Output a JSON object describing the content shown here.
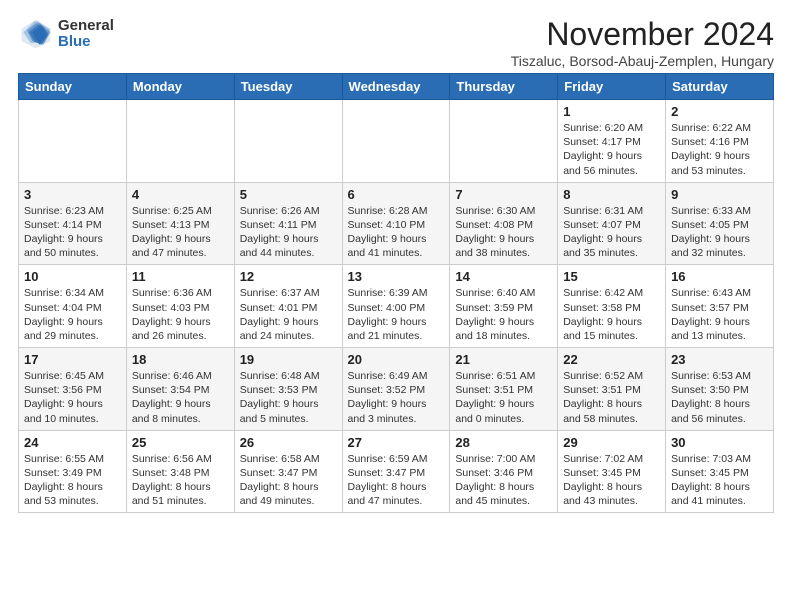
{
  "logo": {
    "general": "General",
    "blue": "Blue"
  },
  "title": "November 2024",
  "location": "Tiszaluc, Borsod-Abauj-Zemplen, Hungary",
  "days_of_week": [
    "Sunday",
    "Monday",
    "Tuesday",
    "Wednesday",
    "Thursday",
    "Friday",
    "Saturday"
  ],
  "weeks": [
    [
      {
        "day": "",
        "info": ""
      },
      {
        "day": "",
        "info": ""
      },
      {
        "day": "",
        "info": ""
      },
      {
        "day": "",
        "info": ""
      },
      {
        "day": "",
        "info": ""
      },
      {
        "day": "1",
        "info": "Sunrise: 6:20 AM\nSunset: 4:17 PM\nDaylight: 9 hours and 56 minutes."
      },
      {
        "day": "2",
        "info": "Sunrise: 6:22 AM\nSunset: 4:16 PM\nDaylight: 9 hours and 53 minutes."
      }
    ],
    [
      {
        "day": "3",
        "info": "Sunrise: 6:23 AM\nSunset: 4:14 PM\nDaylight: 9 hours and 50 minutes."
      },
      {
        "day": "4",
        "info": "Sunrise: 6:25 AM\nSunset: 4:13 PM\nDaylight: 9 hours and 47 minutes."
      },
      {
        "day": "5",
        "info": "Sunrise: 6:26 AM\nSunset: 4:11 PM\nDaylight: 9 hours and 44 minutes."
      },
      {
        "day": "6",
        "info": "Sunrise: 6:28 AM\nSunset: 4:10 PM\nDaylight: 9 hours and 41 minutes."
      },
      {
        "day": "7",
        "info": "Sunrise: 6:30 AM\nSunset: 4:08 PM\nDaylight: 9 hours and 38 minutes."
      },
      {
        "day": "8",
        "info": "Sunrise: 6:31 AM\nSunset: 4:07 PM\nDaylight: 9 hours and 35 minutes."
      },
      {
        "day": "9",
        "info": "Sunrise: 6:33 AM\nSunset: 4:05 PM\nDaylight: 9 hours and 32 minutes."
      }
    ],
    [
      {
        "day": "10",
        "info": "Sunrise: 6:34 AM\nSunset: 4:04 PM\nDaylight: 9 hours and 29 minutes."
      },
      {
        "day": "11",
        "info": "Sunrise: 6:36 AM\nSunset: 4:03 PM\nDaylight: 9 hours and 26 minutes."
      },
      {
        "day": "12",
        "info": "Sunrise: 6:37 AM\nSunset: 4:01 PM\nDaylight: 9 hours and 24 minutes."
      },
      {
        "day": "13",
        "info": "Sunrise: 6:39 AM\nSunset: 4:00 PM\nDaylight: 9 hours and 21 minutes."
      },
      {
        "day": "14",
        "info": "Sunrise: 6:40 AM\nSunset: 3:59 PM\nDaylight: 9 hours and 18 minutes."
      },
      {
        "day": "15",
        "info": "Sunrise: 6:42 AM\nSunset: 3:58 PM\nDaylight: 9 hours and 15 minutes."
      },
      {
        "day": "16",
        "info": "Sunrise: 6:43 AM\nSunset: 3:57 PM\nDaylight: 9 hours and 13 minutes."
      }
    ],
    [
      {
        "day": "17",
        "info": "Sunrise: 6:45 AM\nSunset: 3:56 PM\nDaylight: 9 hours and 10 minutes."
      },
      {
        "day": "18",
        "info": "Sunrise: 6:46 AM\nSunset: 3:54 PM\nDaylight: 9 hours and 8 minutes."
      },
      {
        "day": "19",
        "info": "Sunrise: 6:48 AM\nSunset: 3:53 PM\nDaylight: 9 hours and 5 minutes."
      },
      {
        "day": "20",
        "info": "Sunrise: 6:49 AM\nSunset: 3:52 PM\nDaylight: 9 hours and 3 minutes."
      },
      {
        "day": "21",
        "info": "Sunrise: 6:51 AM\nSunset: 3:51 PM\nDaylight: 9 hours and 0 minutes."
      },
      {
        "day": "22",
        "info": "Sunrise: 6:52 AM\nSunset: 3:51 PM\nDaylight: 8 hours and 58 minutes."
      },
      {
        "day": "23",
        "info": "Sunrise: 6:53 AM\nSunset: 3:50 PM\nDaylight: 8 hours and 56 minutes."
      }
    ],
    [
      {
        "day": "24",
        "info": "Sunrise: 6:55 AM\nSunset: 3:49 PM\nDaylight: 8 hours and 53 minutes."
      },
      {
        "day": "25",
        "info": "Sunrise: 6:56 AM\nSunset: 3:48 PM\nDaylight: 8 hours and 51 minutes."
      },
      {
        "day": "26",
        "info": "Sunrise: 6:58 AM\nSunset: 3:47 PM\nDaylight: 8 hours and 49 minutes."
      },
      {
        "day": "27",
        "info": "Sunrise: 6:59 AM\nSunset: 3:47 PM\nDaylight: 8 hours and 47 minutes."
      },
      {
        "day": "28",
        "info": "Sunrise: 7:00 AM\nSunset: 3:46 PM\nDaylight: 8 hours and 45 minutes."
      },
      {
        "day": "29",
        "info": "Sunrise: 7:02 AM\nSunset: 3:45 PM\nDaylight: 8 hours and 43 minutes."
      },
      {
        "day": "30",
        "info": "Sunrise: 7:03 AM\nSunset: 3:45 PM\nDaylight: 8 hours and 41 minutes."
      }
    ]
  ]
}
